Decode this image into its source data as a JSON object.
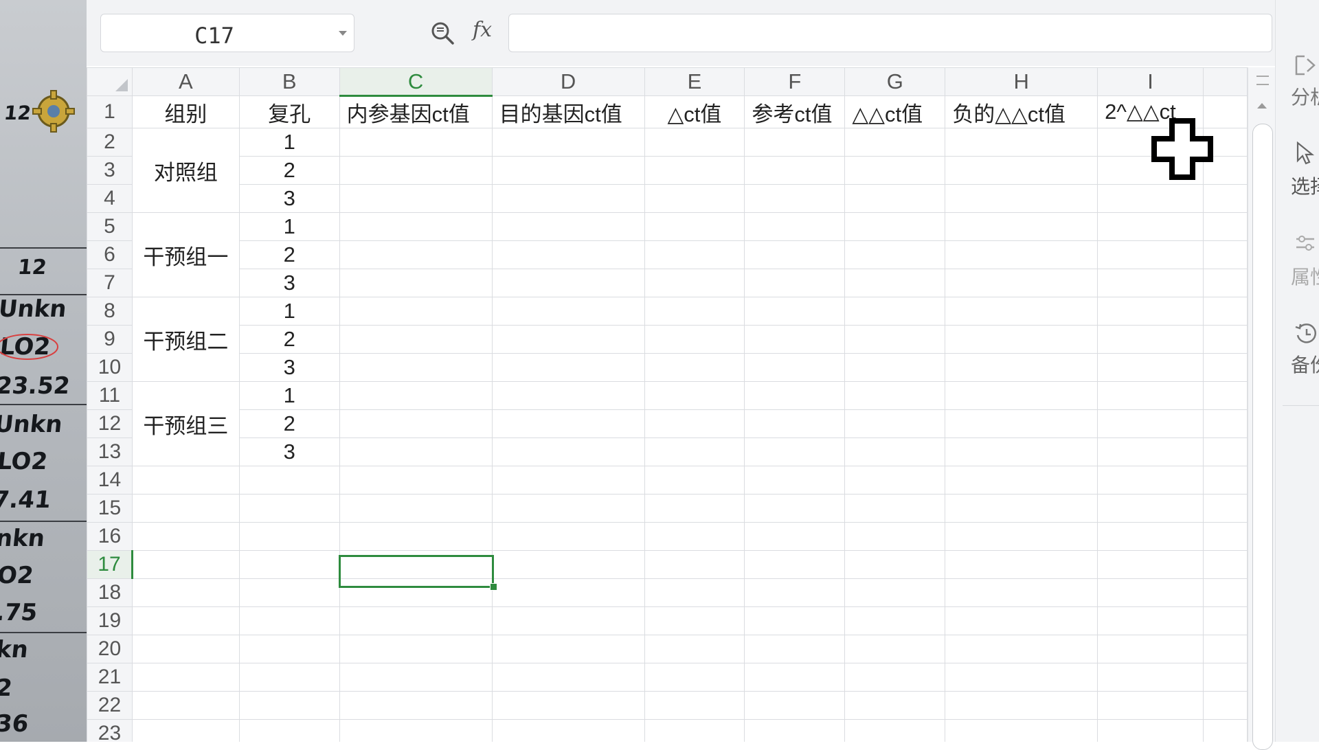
{
  "name_box": {
    "value": "C17"
  },
  "formula_bar": {
    "fx_label": "fx",
    "value": ""
  },
  "columns": [
    "A",
    "B",
    "C",
    "D",
    "E",
    "F",
    "G",
    "H",
    "I"
  ],
  "rows": [
    "1",
    "2",
    "3",
    "4",
    "5",
    "6",
    "7",
    "8",
    "9",
    "10",
    "11",
    "12",
    "13",
    "14",
    "15",
    "16",
    "17",
    "18",
    "19",
    "20",
    "21",
    "22",
    "23"
  ],
  "header_row": [
    "组别",
    "复孔",
    "内参基因ct值",
    "目的基因ct值",
    "△ct值",
    "参考ct值",
    "△△ct值",
    "负的△△ct值",
    "2^△△ct"
  ],
  "groups": [
    "对照组",
    "干预组一",
    "干预组二",
    "干预组三"
  ],
  "replicates": [
    "1",
    "2",
    "3",
    "1",
    "2",
    "3",
    "1",
    "2",
    "3",
    "1",
    "2",
    "3"
  ],
  "selected_cell": "C17",
  "side_panel": {
    "items": [
      "分析",
      "选择",
      "属性",
      "备份"
    ]
  },
  "background_photo": {
    "texts": [
      "12",
      "Unkn",
      "LO2",
      "23.52",
      "Unkn",
      "LO2",
      "7.41",
      "nkn",
      "O2",
      ".75",
      "kn",
      "2",
      "36"
    ]
  }
}
